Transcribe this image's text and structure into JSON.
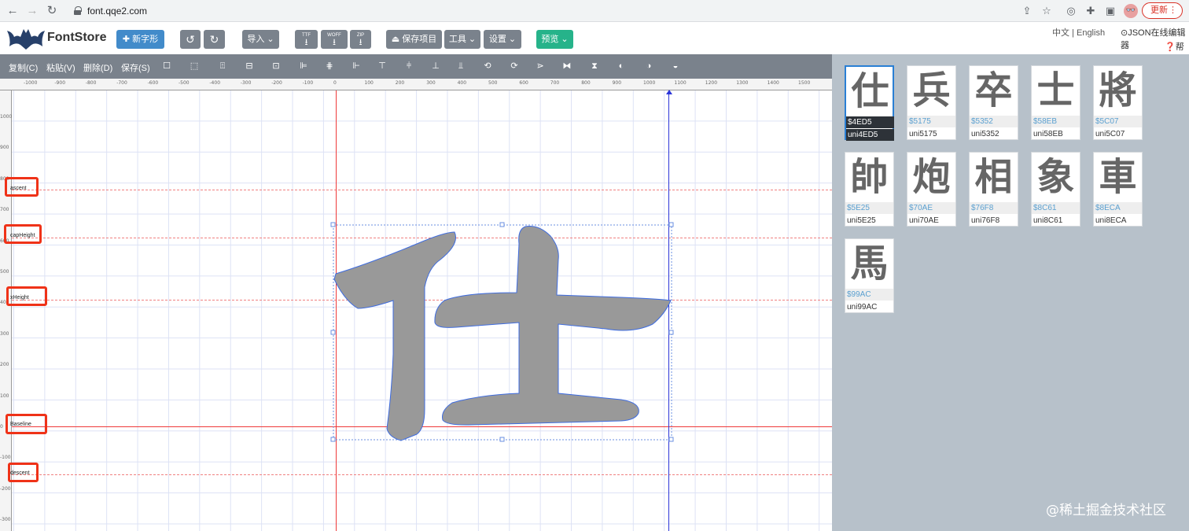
{
  "browser": {
    "url": "font.qqe2.com",
    "update_label": "更新",
    "update_more": "⋮"
  },
  "header": {
    "logo_text": "FontStore",
    "new_glyph_label": "新字形",
    "import_label": "导入",
    "import_formats": [
      "TTF",
      "WOFF",
      "ZIP"
    ],
    "save_project_label": "保存项目",
    "tools_label": "工具",
    "settings_label": "设置",
    "preview_label": "预览",
    "lang_zh": "中文",
    "lang_sep": "|",
    "lang_en": "English",
    "json_editor_label": "JSON在线编辑器",
    "help_label": "帮助"
  },
  "toolbar": {
    "copy_label": "复制(C)",
    "paste_label": "粘贴(V)",
    "delete_label": "删除(D)",
    "save_label": "保存(S)"
  },
  "ruler": {
    "x_labels": [
      "-1000",
      "-900",
      "-800",
      "-700",
      "-600",
      "-500",
      "-400",
      "-300",
      "-200",
      "-100",
      "0",
      "100",
      "200",
      "300",
      "400",
      "500",
      "600",
      "700",
      "800",
      "900",
      "1000",
      "1100",
      "1200",
      "1300",
      "1400",
      "1500"
    ],
    "y_labels": [
      "1000",
      "900",
      "800",
      "700",
      "600",
      "500",
      "400",
      "300",
      "200",
      "100",
      "0",
      "-100",
      "-200",
      "-300"
    ]
  },
  "metrics": {
    "ascent_label": "ascent",
    "cap_height_label": "capHeight",
    "x_height_label": "xHeight",
    "baseline_label": "Baseline",
    "descent_label": "descent"
  },
  "glyphs": [
    {
      "char": "仕",
      "code": "$4ED5",
      "name": "uni4ED5",
      "selected": true
    },
    {
      "char": "兵",
      "code": "$5175",
      "name": "uni5175"
    },
    {
      "char": "卒",
      "code": "$5352",
      "name": "uni5352"
    },
    {
      "char": "士",
      "code": "$58EB",
      "name": "uni58EB"
    },
    {
      "char": "將",
      "code": "$5C07",
      "name": "uni5C07"
    },
    {
      "char": "帥",
      "code": "$5E25",
      "name": "uni5E25"
    },
    {
      "char": "炮",
      "code": "$70AE",
      "name": "uni70AE"
    },
    {
      "char": "相",
      "code": "$76F8",
      "name": "uni76F8"
    },
    {
      "char": "象",
      "code": "$8C61",
      "name": "uni8C61"
    },
    {
      "char": "車",
      "code": "$8ECA",
      "name": "uni8ECA"
    },
    {
      "char": "馬",
      "code": "$99AC",
      "name": "uni99AC"
    }
  ],
  "watermark": "@稀土掘金技术社区",
  "colors": {
    "accent_blue": "#428bca",
    "preview_green": "#26b38a",
    "toolbar_gray": "#7a828c",
    "highlight_red": "#ef3218",
    "glyph_fill": "#999999"
  }
}
